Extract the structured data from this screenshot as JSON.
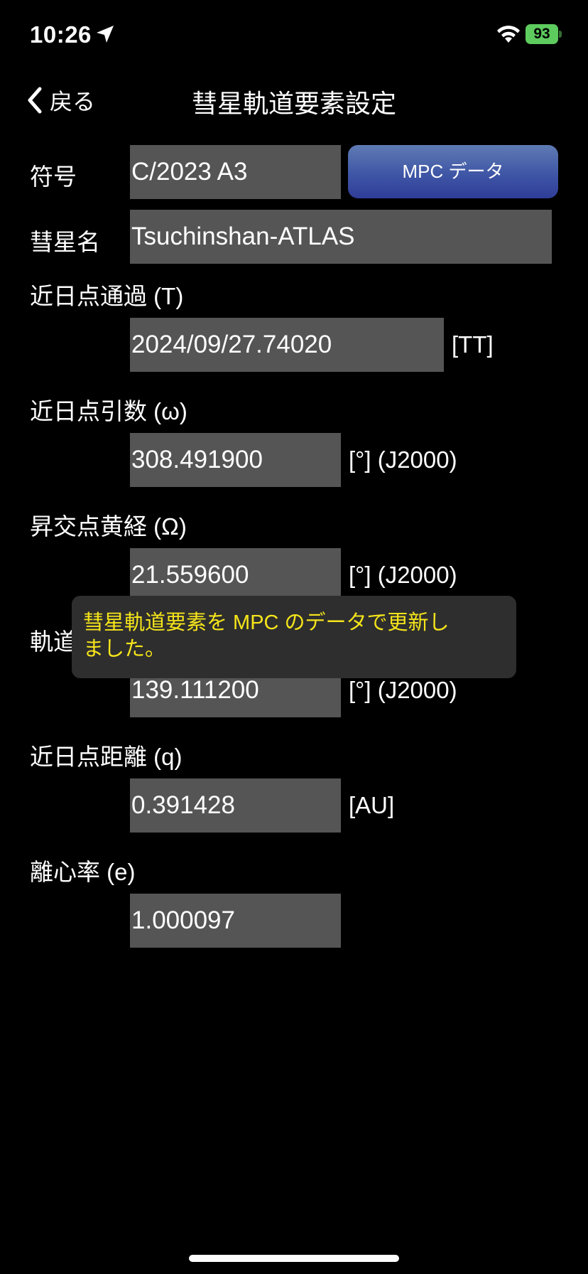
{
  "status_bar": {
    "time": "10:26",
    "battery": "93",
    "battery_color": "#5ecb5e"
  },
  "nav": {
    "back_label": "戻る",
    "title": "彗星軌道要素設定"
  },
  "form": {
    "designation_label": "符号",
    "designation_value": "C/2023 A3",
    "mpc_button_label": "MPC データ",
    "name_label": "彗星名",
    "name_value": "Tsuchinshan-ATLAS",
    "perihelion_time_label": "近日点通過 (T)",
    "perihelion_time_value": "2024/09/27.74020",
    "perihelion_time_unit": "[TT]",
    "arg_perihelion_label": "近日点引数 (ω)",
    "arg_perihelion_value": "308.491900",
    "arg_perihelion_unit": "[°] (J2000)",
    "asc_node_label": "昇交点黄経 (Ω)",
    "asc_node_value": "21.559600",
    "asc_node_unit": "[°] (J2000)",
    "inclination_label": "軌道",
    "inclination_value": "139.111200",
    "inclination_unit": "[°] (J2000)",
    "perihelion_dist_label": "近日点距離 (q)",
    "perihelion_dist_value": "0.391428",
    "perihelion_dist_unit": "[AU]",
    "eccentricity_label": "離心率 (e)",
    "eccentricity_value": "1.000097"
  },
  "toast": {
    "line1": "彗星軌道要素を MPC のデータで更新し",
    "line2": "ました。",
    "color": "#f5e51a"
  }
}
